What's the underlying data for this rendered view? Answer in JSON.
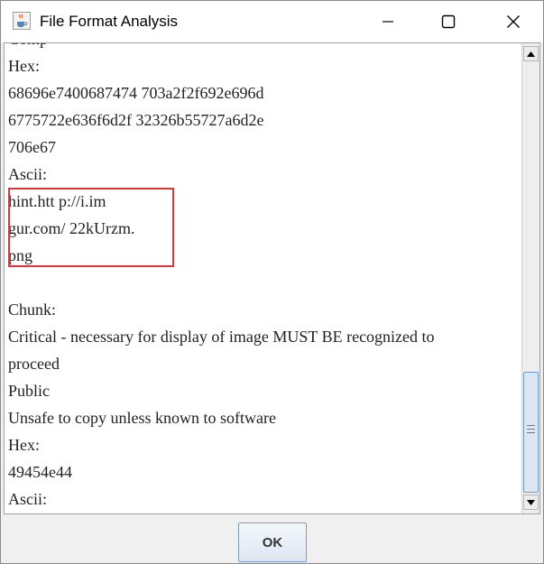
{
  "window": {
    "title": "File Format Analysis"
  },
  "content": {
    "lines": [
      "Comp",
      "Hex:",
      "68696e7400687474 703a2f2f692e696d",
      "6775722e636f6d2f 32326b55727a6d2e",
      "706e67",
      "Ascii:",
      "hint.htt p://i.im",
      "gur.com/ 22kUrzm.",
      "png",
      "",
      "Chunk:",
      "Critical - necessary for display of image MUST BE recognized to",
      "proceed",
      "Public",
      "Unsafe to copy unless known to software",
      "Hex:",
      "49454e44",
      "Ascii:"
    ]
  },
  "footer": {
    "ok_label": "OK"
  },
  "colors": {
    "highlight": "#e0333a",
    "thumb": "#dbe7f3",
    "thumb_border": "#6e9bc9"
  },
  "icons": {
    "app": "java-coffee-cup-icon",
    "minimize": "minimize-icon",
    "maximize": "maximize-icon",
    "close": "close-icon"
  }
}
